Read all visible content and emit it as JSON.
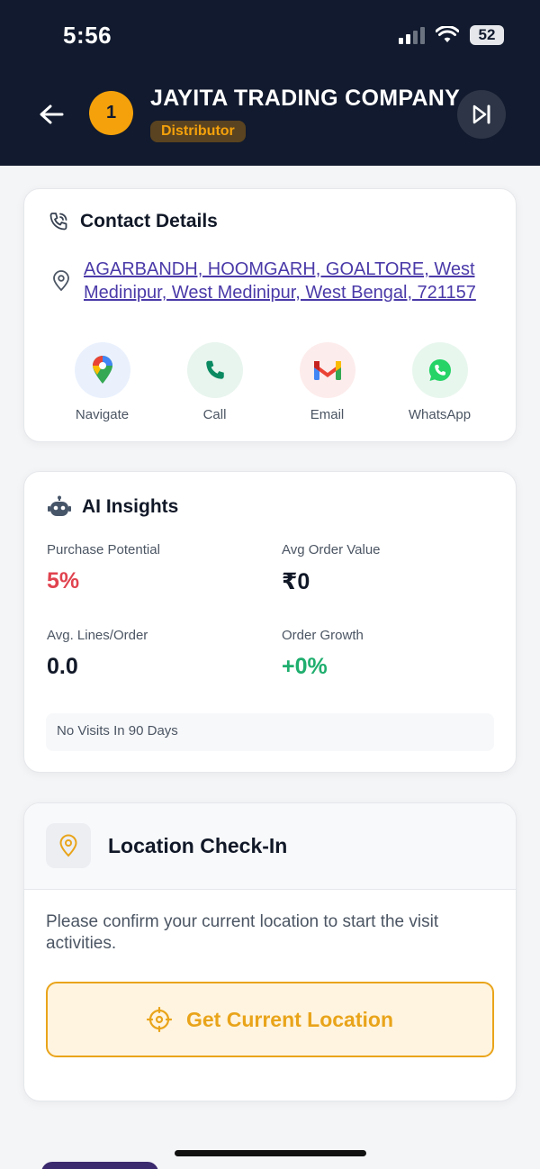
{
  "status_bar": {
    "time": "5:56",
    "battery": "52"
  },
  "header": {
    "rank": "1",
    "company_name": "JAYITA TRADING COMPANY",
    "role": "Distributor"
  },
  "contact": {
    "title": "Contact Details",
    "address": "AGARBANDH, HOOMGARH, GOALTORE, West Medinipur, West Medinipur, West Bengal, 721157",
    "actions": [
      {
        "label": "Navigate",
        "icon": "google-maps-pin-icon"
      },
      {
        "label": "Call",
        "icon": "phone-icon"
      },
      {
        "label": "Email",
        "icon": "gmail-icon"
      },
      {
        "label": "WhatsApp",
        "icon": "whatsapp-icon"
      }
    ]
  },
  "insights": {
    "title": "AI Insights",
    "purchase_potential_label": "Purchase Potential",
    "purchase_potential_value": "5%",
    "avg_order_value_label": "Avg Order Value",
    "avg_order_value_value": "₹0",
    "avg_lines_label": "Avg. Lines/Order",
    "avg_lines_value": "0.0",
    "order_growth_label": "Order Growth",
    "order_growth_value": "+0%",
    "visits_note": "No Visits In 90 Days"
  },
  "checkin": {
    "title": "Location Check-In",
    "description": "Please confirm your current location to start the visit activities.",
    "button_label": "Get Current Location"
  },
  "colors": {
    "header_bg": "#111a2e",
    "accent": "#f4a10b",
    "negative": "#e0434f",
    "positive": "#1fae6e",
    "link": "#4a3aa8"
  }
}
